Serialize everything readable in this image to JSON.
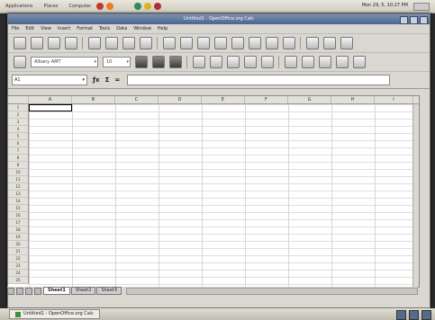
{
  "topbar": {
    "menus": [
      "Applications",
      "Places",
      "Computer"
    ],
    "clock": "Mon 29, 5, 10:27 PM"
  },
  "window": {
    "title": "Untitled1 - OpenOffice.org Calc",
    "menu": [
      "File",
      "Edit",
      "View",
      "Insert",
      "Format",
      "Tools",
      "Data",
      "Window",
      "Help"
    ]
  },
  "format_toolbar": {
    "font_name": "Albany AMT",
    "font_size": "10"
  },
  "formula_bar": {
    "name_box": "A1",
    "func_wizard": "ƒx",
    "sum": "Σ",
    "equals": "="
  },
  "sheet": {
    "columns": [
      "A",
      "B",
      "C",
      "D",
      "E",
      "F",
      "G",
      "H",
      "I"
    ],
    "rows": [
      "1",
      "2",
      "3",
      "4",
      "5",
      "6",
      "7",
      "8",
      "9",
      "10",
      "11",
      "12",
      "13",
      "14",
      "15",
      "16",
      "17",
      "18",
      "19",
      "20",
      "21",
      "22",
      "23",
      "24",
      "25"
    ],
    "tabs": [
      "Sheet1",
      "Sheet2",
      "Sheet3"
    ]
  },
  "taskbar": {
    "task_label": "Untitled1 - OpenOffice.org Calc"
  }
}
